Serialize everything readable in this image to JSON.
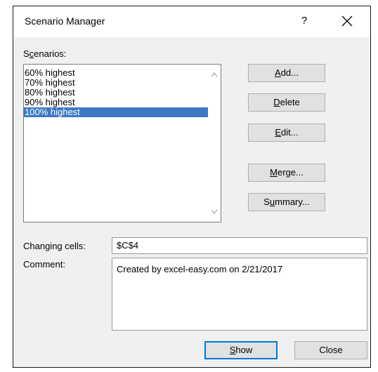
{
  "dialog": {
    "title": "Scenario Manager",
    "help_label": "?",
    "close_icon": "close-icon"
  },
  "scenarios": {
    "label_pre": "S",
    "label_acc": "c",
    "label_post": "enarios:",
    "items": [
      "60% highest",
      "70% highest",
      "80% highest",
      "90% highest",
      "100% highest"
    ],
    "selected": "100% highest",
    "selection_color": "#3d78c4"
  },
  "buttons": {
    "add": {
      "acc": "A",
      "rest": "dd..."
    },
    "delete": {
      "acc": "D",
      "rest": "elete"
    },
    "edit": {
      "acc": "E",
      "rest": "dit..."
    },
    "merge": {
      "acc": "M",
      "rest": "erge..."
    },
    "summary": {
      "pre": "S",
      "acc": "u",
      "rest": "mmary..."
    },
    "show": {
      "acc": "S",
      "rest": "how"
    },
    "close": "Close"
  },
  "fields": {
    "changing_cells_label": "Changing cells:",
    "changing_cells_value": "$C$4",
    "comment_label": "Comment:",
    "comment_value": "Created by excel-easy.com on 2/21/2017"
  },
  "colors": {
    "accent": "#0078d7"
  }
}
